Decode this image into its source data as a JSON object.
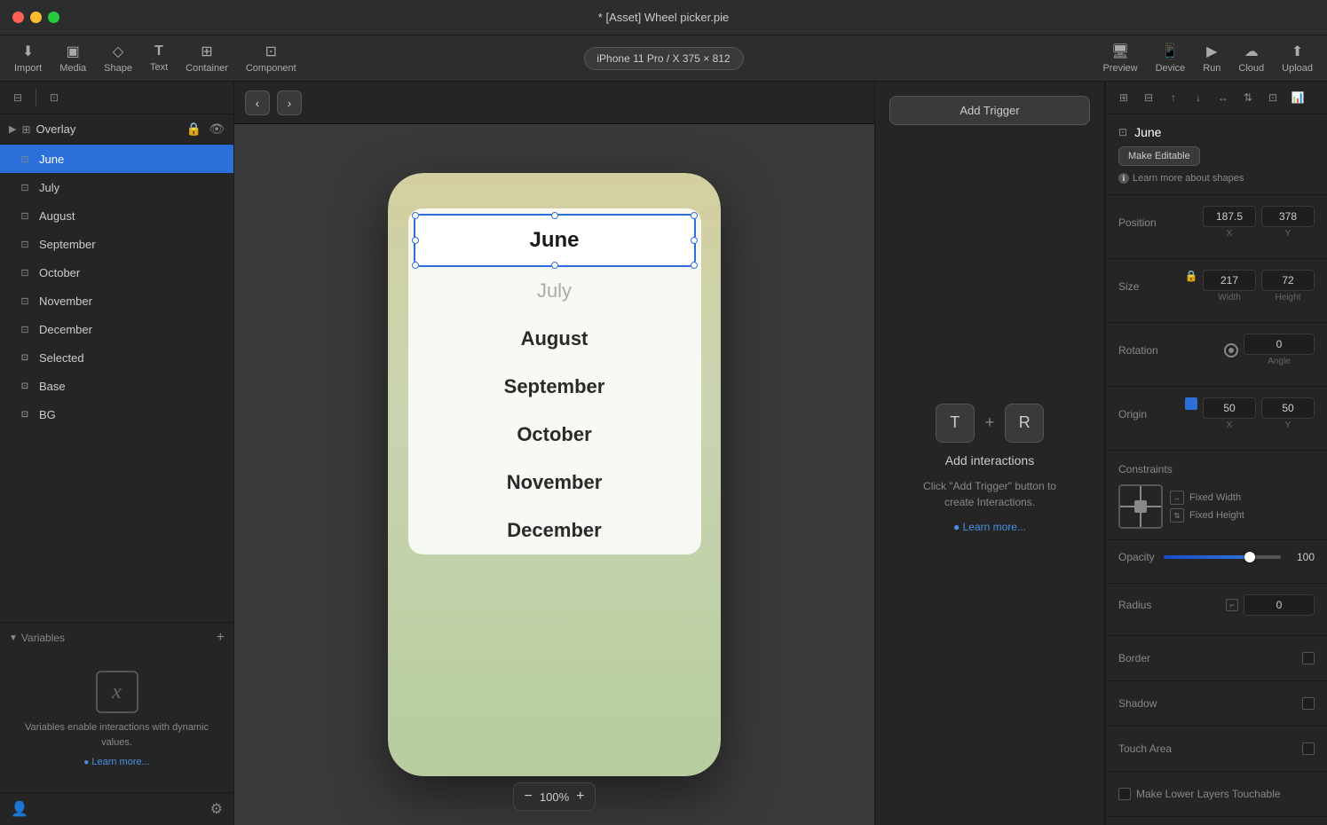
{
  "titlebar": {
    "title": "* [Asset] Wheel picker.pie"
  },
  "toolbar": {
    "items": [
      {
        "label": "Import",
        "icon": "⬇"
      },
      {
        "label": "Media",
        "icon": "⬜"
      },
      {
        "label": "Shape",
        "icon": "◇"
      },
      {
        "label": "Text",
        "icon": "T"
      },
      {
        "label": "Container",
        "icon": "⊞"
      },
      {
        "label": "Component",
        "icon": "⊡"
      }
    ],
    "device_selector": "iPhone 11 Pro / X  375 × 812",
    "right_items": [
      {
        "label": "Preview",
        "icon": "🖥"
      },
      {
        "label": "Device",
        "icon": "📱"
      },
      {
        "label": "Run",
        "icon": "▶"
      },
      {
        "label": "Cloud",
        "icon": "☁"
      },
      {
        "label": "Upload",
        "icon": "⬆"
      }
    ]
  },
  "sidebar": {
    "overlay_label": "Overlay",
    "layers": [
      {
        "label": "June",
        "selected": true
      },
      {
        "label": "July",
        "selected": false
      },
      {
        "label": "August",
        "selected": false
      },
      {
        "label": "September",
        "selected": false
      },
      {
        "label": "October",
        "selected": false
      },
      {
        "label": "November",
        "selected": false
      },
      {
        "label": "December",
        "selected": false
      },
      {
        "label": "Selected",
        "selected": false
      },
      {
        "label": "Base",
        "selected": false
      },
      {
        "label": "BG",
        "selected": false
      }
    ]
  },
  "variables": {
    "title": "Variables",
    "description": "Variables enable interactions with dynamic values.",
    "link": "Learn more..."
  },
  "canvas": {
    "zoom": "100%",
    "months": [
      "June",
      "July",
      "August",
      "September",
      "October",
      "November",
      "December"
    ]
  },
  "interactions": {
    "add_trigger_label": "Add Trigger",
    "title": "Add interactions",
    "description": "Click \"Add Trigger\" button to create Interactions.",
    "link": "Learn more..."
  },
  "properties": {
    "component_icon": "⊡",
    "component_name": "June",
    "make_editable_label": "Make Editable",
    "help_text": "Learn more about shapes",
    "position": {
      "label": "Position",
      "x_value": "187.5",
      "x_label": "X",
      "y_value": "378",
      "y_label": "Y"
    },
    "size": {
      "label": "Size",
      "width_value": "217",
      "width_label": "Width",
      "height_value": "72",
      "height_label": "Height"
    },
    "rotation": {
      "label": "Rotation",
      "value": "0",
      "sub_label": "Angle"
    },
    "origin": {
      "label": "Origin",
      "x_value": "50",
      "x_label": "X",
      "y_value": "50",
      "y_label": "Y"
    },
    "constraints_label": "Constraints",
    "fixed_width_label": "Fixed Width",
    "fixed_height_label": "Fixed Height",
    "opacity": {
      "label": "Opacity",
      "value": "100"
    },
    "radius": {
      "label": "Radius",
      "value": "0"
    },
    "border_label": "Border",
    "shadow_label": "Shadow",
    "touch_area_label": "Touch Area",
    "make_lower_layers_label": "Make Lower Layers Touchable"
  },
  "props_toolbar": {
    "icons": [
      "⊞",
      "⊟",
      "↑",
      "↓",
      "↔",
      "⇅",
      "⊡",
      "📊"
    ]
  }
}
